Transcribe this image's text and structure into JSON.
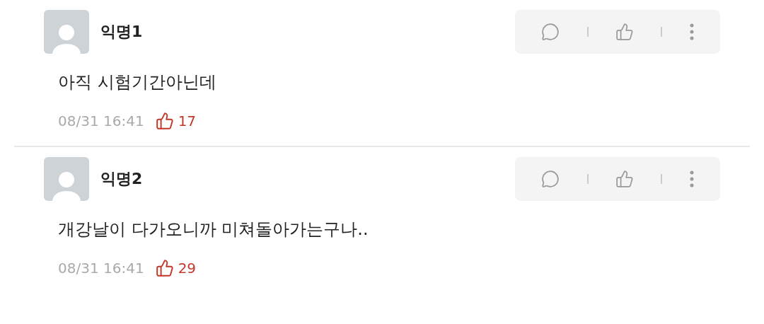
{
  "comments": [
    {
      "author": "익명1",
      "text": "아직 시험기간아닌데",
      "time": "08/31 16:41",
      "likes": "17"
    },
    {
      "author": "익명2",
      "text": "개강날이 다가오니까 미쳐돌아가는구나..",
      "time": "08/31 16:41",
      "likes": "29"
    }
  ]
}
